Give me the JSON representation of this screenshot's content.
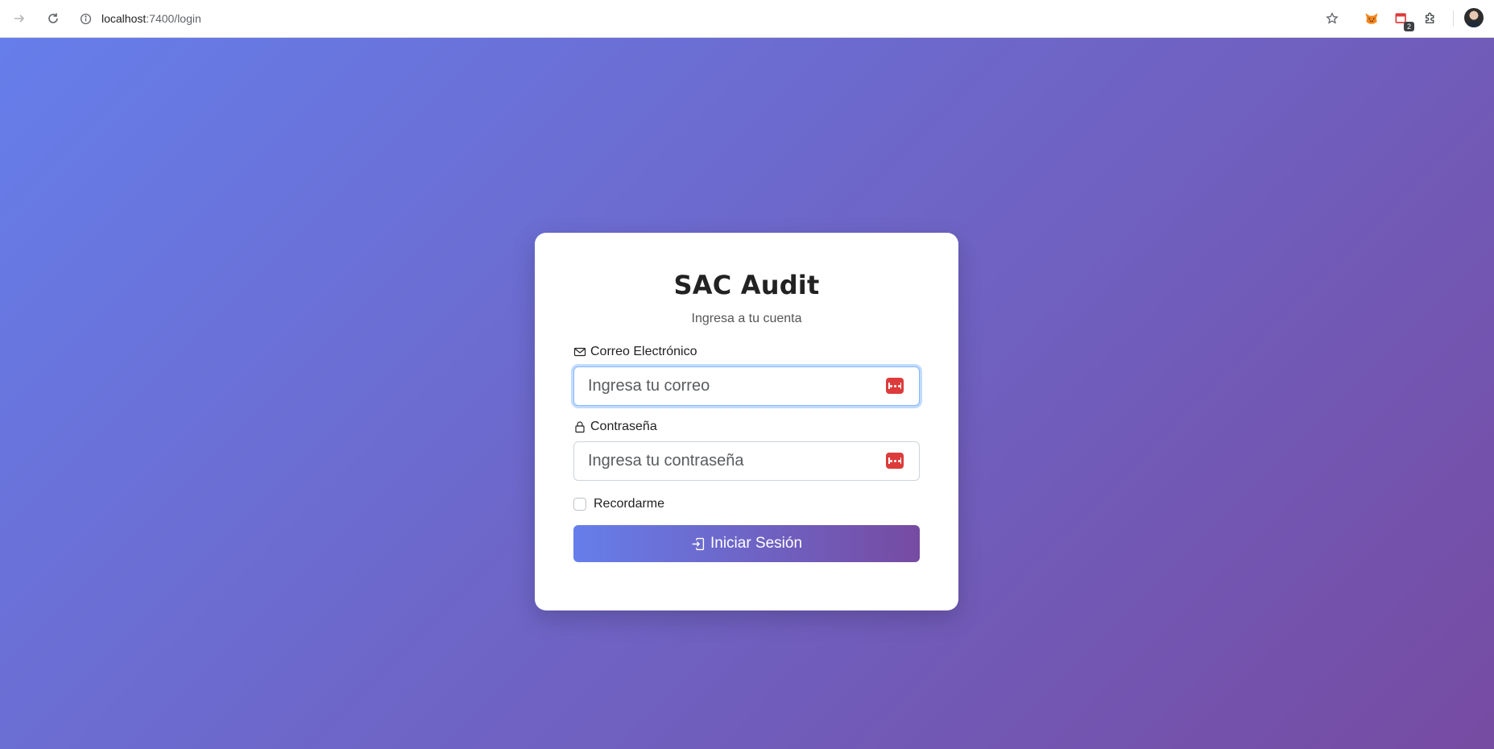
{
  "browser": {
    "url_host": "localhost",
    "url_path": ":7400/login",
    "extension_badge": "2",
    "icons": {
      "back": "arrow-left-icon",
      "reload": "reload-icon",
      "site_info": "info-icon",
      "bookmark": "star-icon",
      "extensions": "puzzle-icon"
    }
  },
  "login": {
    "title": "SAC Audit",
    "subtitle": "Ingresa a tu cuenta",
    "email": {
      "label": "Correo Electrónico",
      "placeholder": "Ingresa tu correo",
      "value": "",
      "icon": "envelope-icon"
    },
    "password": {
      "label": "Contraseña",
      "placeholder": "Ingresa tu contraseña",
      "value": "",
      "icon": "lock-icon"
    },
    "remember_label": "Recordarme",
    "remember_checked": false,
    "submit_label": "Iniciar Sesión",
    "submit_icon": "sign-in-icon"
  },
  "colors": {
    "gradient_start": "#667eea",
    "gradient_end": "#764ba2",
    "password_manager_red": "#dd3b3b",
    "focus_border": "#86b7fe"
  }
}
